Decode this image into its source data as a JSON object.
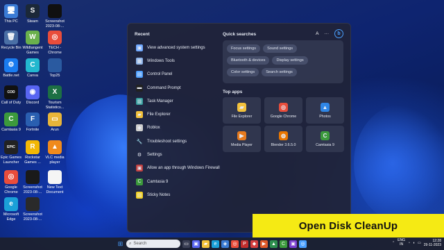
{
  "desktop_icons": [
    {
      "label": "This PC",
      "glyph": "🖥",
      "bg": "#3a7bd5"
    },
    {
      "label": "Steam",
      "glyph": "S",
      "bg": "#1b2838"
    },
    {
      "label": "Screenshot 2023-08-...",
      "glyph": "",
      "bg": "#101010"
    },
    {
      "label": "Recycle Bin",
      "glyph": "🗑",
      "bg": "#4a6fa5"
    },
    {
      "label": "Wildtangent Games",
      "glyph": "W",
      "bg": "#6ab04c"
    },
    {
      "label": "TECH - Chrome",
      "glyph": "◎",
      "bg": "#e94d3b"
    },
    {
      "label": "Battle.net",
      "glyph": "⚙",
      "bg": "#1a7cf0"
    },
    {
      "label": "Canva",
      "glyph": "C",
      "bg": "#22b8cf"
    },
    {
      "label": "Top25",
      "glyph": "",
      "bg": "#2a5aa0"
    },
    {
      "label": "Call of Duty",
      "glyph": "COD",
      "bg": "#111111"
    },
    {
      "label": "Discord",
      "glyph": "◉",
      "bg": "#5865f2"
    },
    {
      "label": "Tourism Statistics...",
      "glyph": "X",
      "bg": "#1d7044"
    },
    {
      "label": "Camtasia 9",
      "glyph": "C",
      "bg": "#3c9a3c"
    },
    {
      "label": "Fortnite",
      "glyph": "F",
      "bg": "#2a5fb0"
    },
    {
      "label": "Arun",
      "glyph": "▭",
      "bg": "#e8b53a"
    },
    {
      "label": "Epic Games Launcher",
      "glyph": "EPIC",
      "bg": "#222222"
    },
    {
      "label": "Rockstar Games ...",
      "glyph": "R",
      "bg": "#f2b705"
    },
    {
      "label": "VLC media player",
      "glyph": "▲",
      "bg": "#f08a1c"
    },
    {
      "label": "Google Chrome",
      "glyph": "◎",
      "bg": "#e94d3b"
    },
    {
      "label": "Screenshot 2023-08-...",
      "glyph": "",
      "bg": "#1a1a1a"
    },
    {
      "label": "New Text Document",
      "glyph": "",
      "bg": "#f5f5f5"
    },
    {
      "label": "Microsoft Edge",
      "glyph": "e",
      "bg": "#1ba0d8"
    },
    {
      "label": "Screenshot 2023-08-...",
      "glyph": "",
      "bg": "#2a2a2a"
    }
  ],
  "start_menu": {
    "recent_title": "Recent",
    "recent": [
      {
        "label": "View advanced system settings",
        "glyph": "▣",
        "color": "#6fa8ff"
      },
      {
        "label": "Windows Tools",
        "glyph": "▦",
        "color": "#8fb4e8"
      },
      {
        "label": "Control Panel",
        "glyph": "▤",
        "color": "#4fa0ff"
      },
      {
        "label": "Command Prompt",
        "glyph": "▬",
        "color": "#222222"
      },
      {
        "label": "Task Manager",
        "glyph": "▥",
        "color": "#3aa0a0"
      },
      {
        "label": "File Explorer",
        "glyph": "▰",
        "color": "#f3c23c"
      },
      {
        "label": "Roblox",
        "glyph": "◆",
        "color": "#d0d0d0"
      },
      {
        "label": "Troubleshoot settings",
        "glyph": "🔧",
        "color": "transparent"
      },
      {
        "label": "Settings",
        "glyph": "⚙",
        "color": "transparent"
      },
      {
        "label": "Allow an app through Windows Firewall",
        "glyph": "▣",
        "color": "#c04040"
      },
      {
        "label": "Camtasia 9",
        "glyph": "C",
        "color": "#3c9a3c"
      },
      {
        "label": "Sticky Notes",
        "glyph": "▤",
        "color": "#f2d024"
      }
    ],
    "quick_title": "Quick searches",
    "account_letter": "A",
    "more": "···",
    "bing": "b",
    "quick": [
      "Focus settings",
      "Sound settings",
      "Bluetooth & devices",
      "Display settings",
      "Color settings",
      "Search settings"
    ],
    "top_apps_title": "Top apps",
    "top_apps": [
      {
        "label": "File Explorer",
        "glyph": "▰",
        "color": "#f3c23c"
      },
      {
        "label": "Google Chrome",
        "glyph": "◎",
        "color": "#e94d3b"
      },
      {
        "label": "Photos",
        "glyph": "▲",
        "color": "#2f86e6"
      },
      {
        "label": "Media Player",
        "glyph": "▶",
        "color": "#e67a1e"
      },
      {
        "label": "Blender 3.6.5.0",
        "glyph": "◍",
        "color": "#ea7600"
      },
      {
        "label": "Camtasia 9",
        "glyph": "C",
        "color": "#3c9a3c"
      }
    ]
  },
  "banner": "Open Disk CleanUp",
  "taskbar": {
    "search_placeholder": "Search",
    "icons": [
      {
        "name": "task-view-icon",
        "glyph": "▭",
        "color": "#3a3f55"
      },
      {
        "name": "chat-icon",
        "glyph": "▣",
        "color": "#5865f2"
      },
      {
        "name": "file-explorer-icon",
        "glyph": "▰",
        "color": "#f3c23c"
      },
      {
        "name": "edge-icon",
        "glyph": "e",
        "color": "#1ba0d8"
      },
      {
        "name": "store-icon",
        "glyph": "◈",
        "color": "#3a7bd5"
      },
      {
        "name": "chrome-icon",
        "glyph": "◎",
        "color": "#e94d3b"
      },
      {
        "name": "icon-p",
        "glyph": "P",
        "color": "#c02d2d"
      },
      {
        "name": "app-icon-2",
        "glyph": "◆",
        "color": "#d43f3f"
      },
      {
        "name": "play-icon",
        "glyph": "▶",
        "color": "#e05a2a"
      },
      {
        "name": "app-icon-3",
        "glyph": "▲",
        "color": "#2d8f4e"
      },
      {
        "name": "camtasia-icon",
        "glyph": "C",
        "color": "#3c9a3c"
      },
      {
        "name": "app-icon-4",
        "glyph": "▣",
        "color": "#7a3fd0"
      },
      {
        "name": "app-icon-5",
        "glyph": "◎",
        "color": "#4aa0ff"
      }
    ],
    "lang_top": "ENG",
    "lang_bottom": "IN",
    "time": "12:28",
    "date": "29-11-2023"
  }
}
